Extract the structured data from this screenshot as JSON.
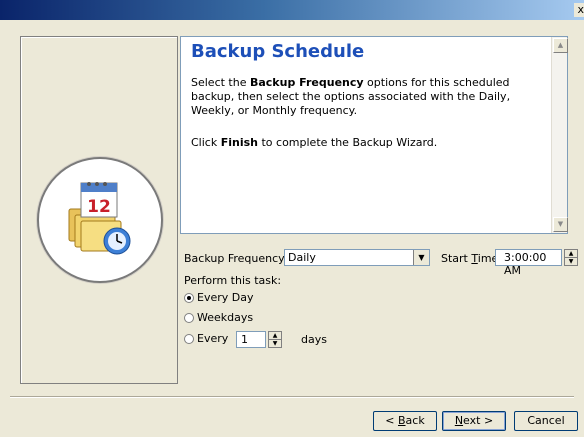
{
  "window": {
    "close_label": "x"
  },
  "header": {
    "title": "Backup Schedule"
  },
  "intro": {
    "line1_pre": "Select the ",
    "line1_bold": "Backup Frequency",
    "line1_post": " options for this scheduled backup, then select the options associated with the Daily, Weekly, or Monthly frequency.",
    "line2_pre": "Click ",
    "line2_bold": "Finish",
    "line2_post": " to complete the Backup Wizard."
  },
  "icon": {
    "name": "calendar-folder-icon",
    "calendar_day": "12"
  },
  "form": {
    "frequency_label": "Backup Frequency:",
    "frequency_value": "Daily",
    "start_time_label_pre": "Start ",
    "start_time_label_u": "T",
    "start_time_label_post": "ime",
    "start_time_value": "3:00:00 AM",
    "perform_label": "Perform this task:",
    "options": {
      "every_day": "Every Day",
      "weekdays": "Weekdays",
      "every": "Every"
    },
    "selected_option": "every_day",
    "every_n_value": "1",
    "days_label": "days"
  },
  "buttons": {
    "back_u": "B",
    "back_rest": "ack",
    "next_u": "N",
    "next_rest": "ext >",
    "cancel": "Cancel"
  }
}
